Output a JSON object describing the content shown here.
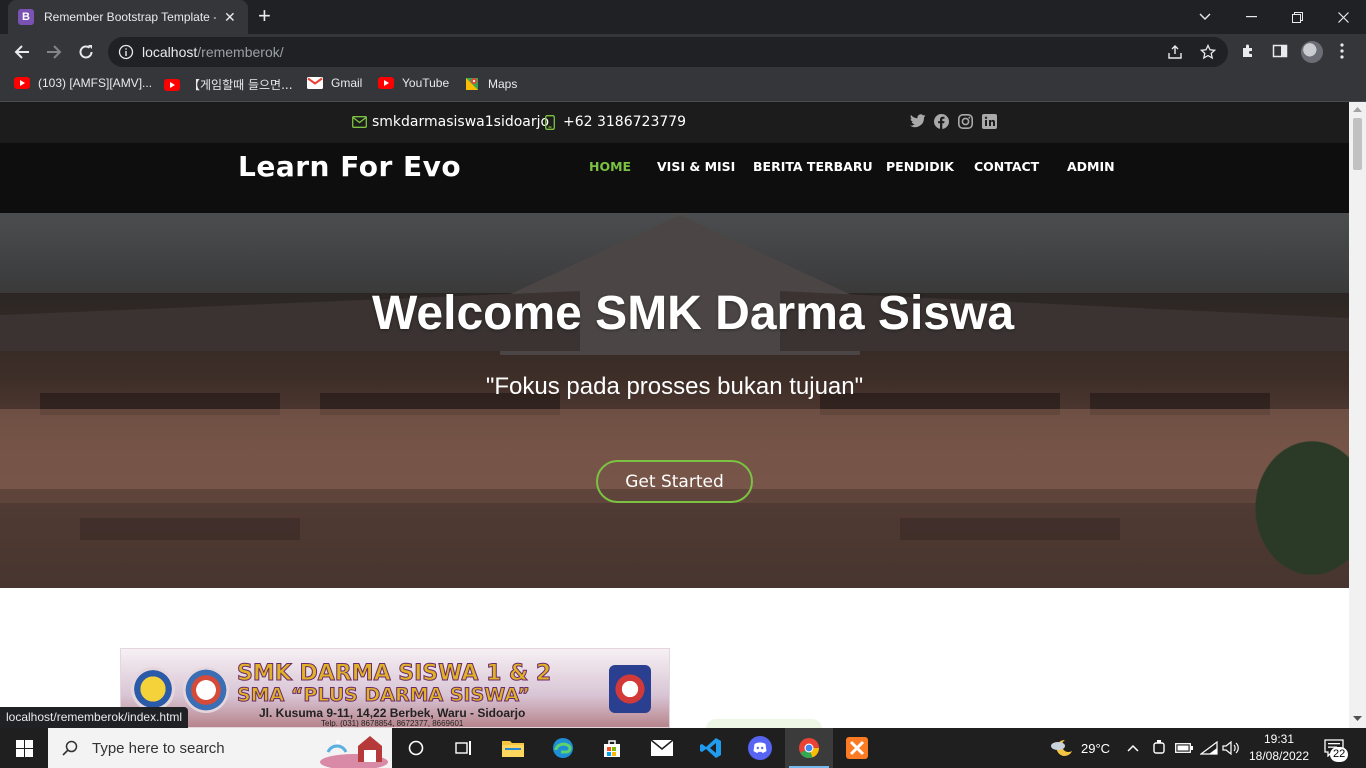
{
  "browser": {
    "tab_title": "Remember Bootstrap Template -",
    "tab_favicon": "B",
    "url_host": "localhost",
    "url_path": "/rememberok/",
    "bookmarks": [
      {
        "label": "(103) [AMFS][AMV]...",
        "icon": "youtube-icon"
      },
      {
        "label": "【게임할때 들으면...",
        "icon": "youtube-icon"
      },
      {
        "label": "Gmail",
        "icon": "gmail-icon"
      },
      {
        "label": "YouTube",
        "icon": "youtube-icon"
      },
      {
        "label": "Maps",
        "icon": "maps-icon"
      }
    ],
    "status_url": "localhost/rememberok/index.html"
  },
  "site": {
    "email": "smkdarmasiswa1sidoarjo",
    "phone": "+62 3186723779",
    "logo": "Learn For Evo",
    "nav": [
      "HOME",
      "VISI & MISI",
      "BERITA TERBARU",
      "PENDIDIK",
      "CONTACT",
      "ADMIN"
    ],
    "active_nav": "HOME",
    "accent_color": "#7cc242",
    "hero": {
      "title": "Welcome SMK Darma Siswa",
      "subtitle": "\"Fokus pada prosses bukan tujuan\"",
      "button": "Get Started"
    },
    "banner": {
      "line1": "SMK DARMA SISWA 1 & 2",
      "line2": "SMA “PLUS DARMA SISWA”",
      "line3": "Jl. Kusuma 9-11, 14,22 Berbek, Waru - Sidoarjo",
      "line4": "Telp. (031) 8678854, 8672377, 8669601"
    }
  },
  "taskbar": {
    "search_placeholder": "Type here to search",
    "weather": "29°C",
    "time": "19:31",
    "date": "18/08/2022",
    "notifications": "22"
  }
}
